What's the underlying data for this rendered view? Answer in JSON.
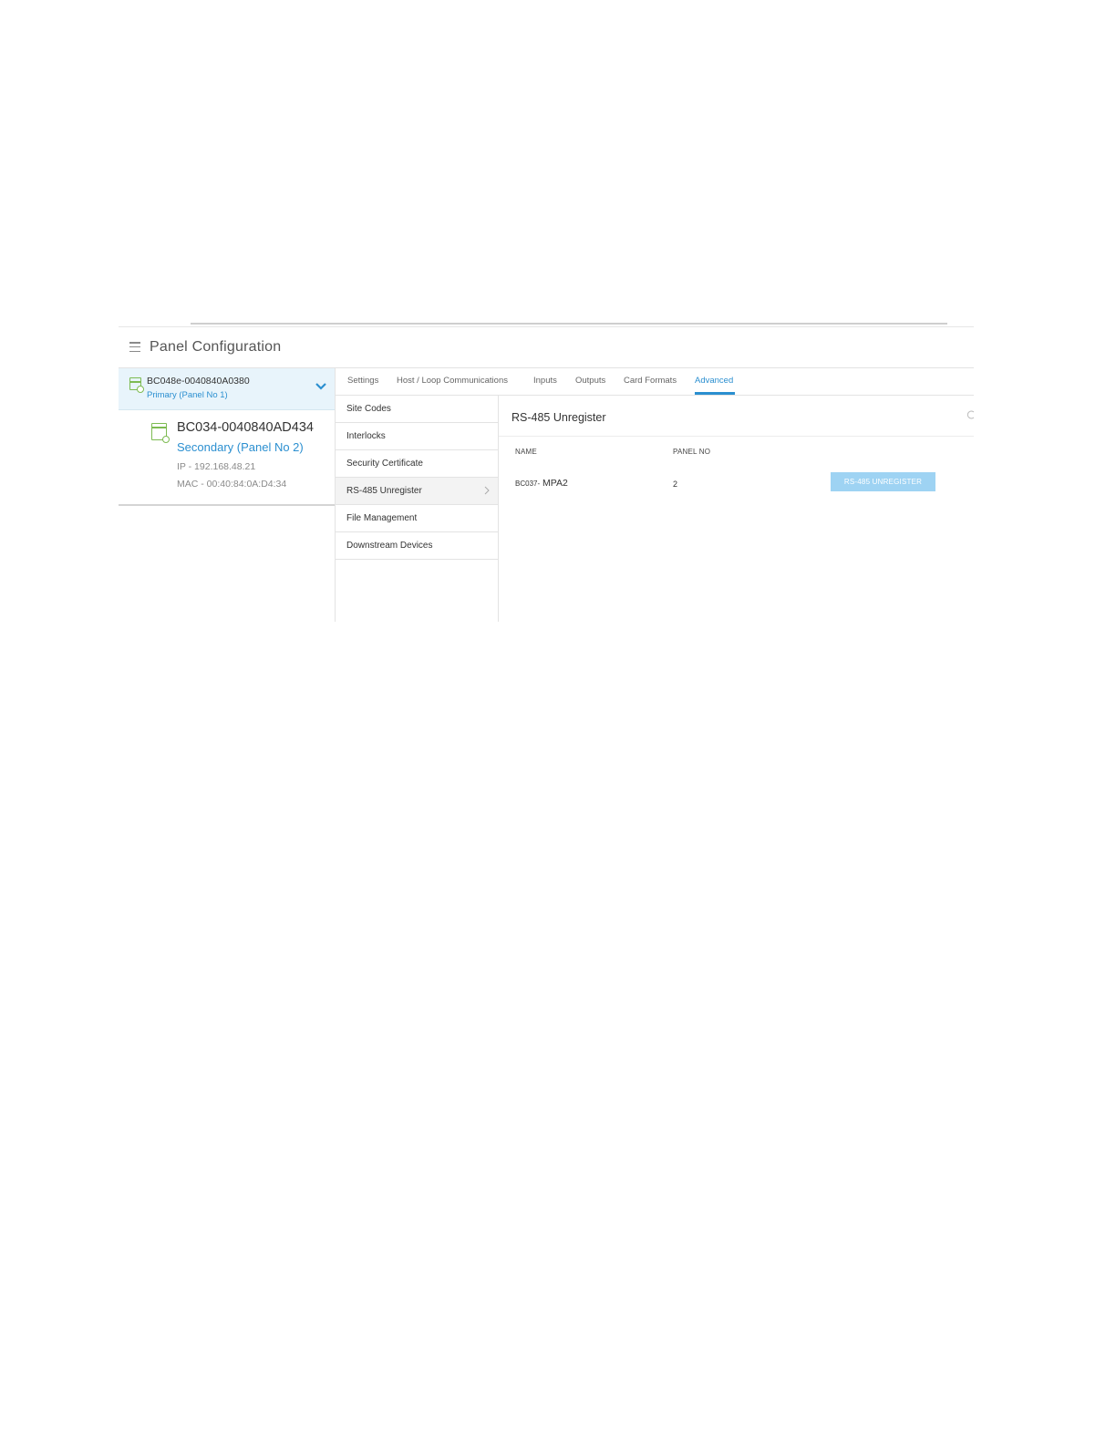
{
  "header": {
    "title": "Panel Configuration"
  },
  "panels": {
    "primary": {
      "name": "BC048e-0040840A0380",
      "subtitle": "Primary (Panel No 1)"
    },
    "secondary": {
      "name": "BC034-0040840AD434",
      "subtitle": "Secondary (Panel No 2)",
      "ip": "IP - 192.168.48.21",
      "mac": "MAC - 00:40:84:0A:D4:34"
    }
  },
  "tabs": [
    {
      "label": "Settings",
      "active": false
    },
    {
      "label": "Host / Loop Communications",
      "active": false
    },
    {
      "label": "Inputs",
      "active": false
    },
    {
      "label": "Outputs",
      "active": false
    },
    {
      "label": "Card Formats",
      "active": false
    },
    {
      "label": "Advanced",
      "active": true
    }
  ],
  "submenu": [
    {
      "label": "Site Codes"
    },
    {
      "label": "Interlocks"
    },
    {
      "label": "Security Certificate"
    },
    {
      "label": "RS-485 Unregister",
      "active": true
    },
    {
      "label": "File Management"
    },
    {
      "label": "Downstream Devices"
    }
  ],
  "content": {
    "title": "RS-485 Unregister",
    "columns": {
      "name": "NAME",
      "panel_no": "PANEL NO"
    },
    "rows": [
      {
        "name_prefix": "BC037-",
        "name": "MPA2",
        "panel_no": "2",
        "action": "RS-485 UNREGISTER"
      }
    ]
  },
  "colors": {
    "accent": "#2b8fd0",
    "button": "#9ed3f3",
    "panel_icon": "#7dbb52",
    "selected_panel_bg": "#e8f4fb"
  },
  "icons": {
    "menu": "hamburger-icon",
    "panel": "panel-device-icon",
    "expand": "chevron-down-icon",
    "submenu_arrow": "chevron-right-icon",
    "refresh": "refresh-icon"
  }
}
